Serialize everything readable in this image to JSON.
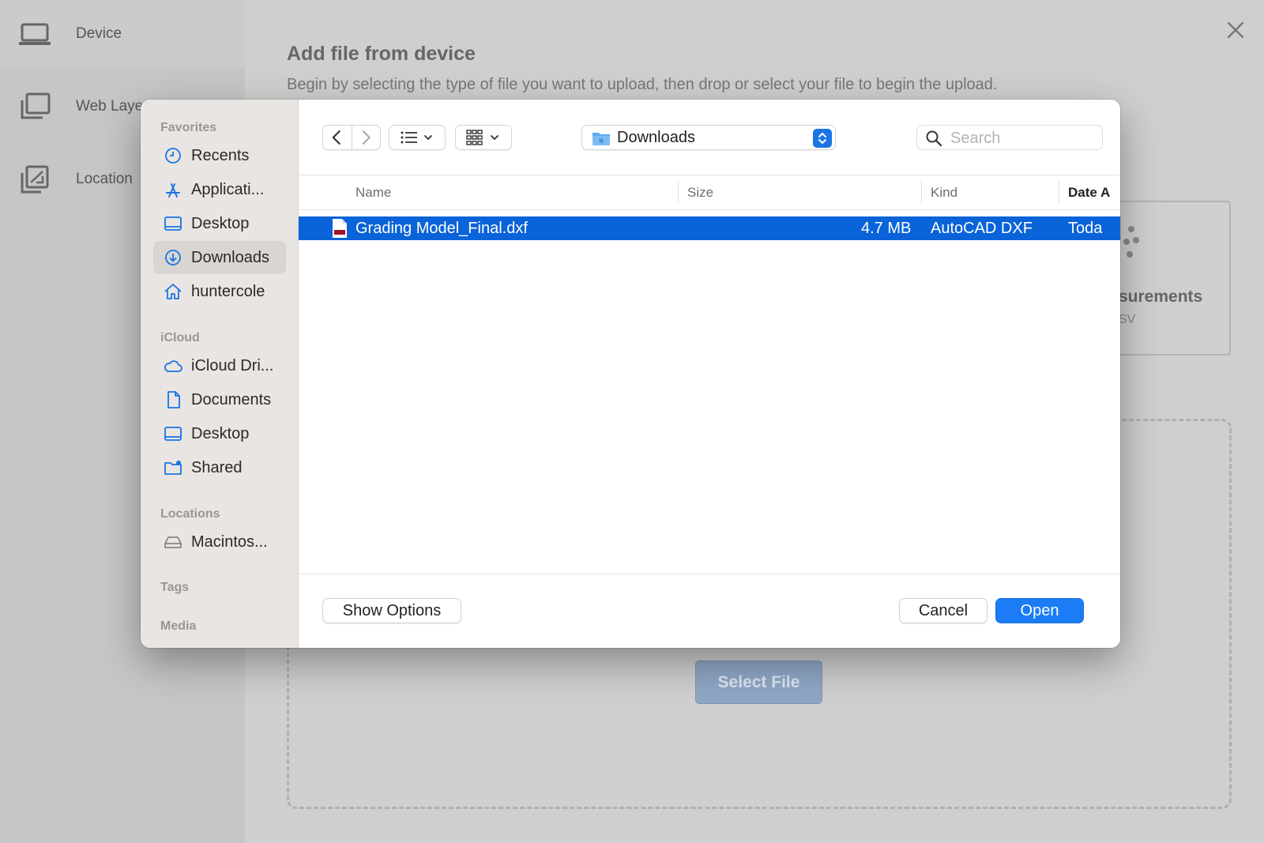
{
  "background": {
    "nav": [
      {
        "label": "Device",
        "icon": "laptop-icon"
      },
      {
        "label": "Web Laye",
        "icon": "layers-icon"
      },
      {
        "label": "Location",
        "icon": "location-layers-icon"
      }
    ],
    "title": "Add file from device",
    "subtitle": "Begin by selecting the type of file you want to upload, then drop or select your file to begin the upload.",
    "card_title": "surements",
    "card_sub": "SV",
    "select_file": "Select File"
  },
  "dialog": {
    "sidebar": {
      "sections": [
        {
          "title": "Favorites",
          "items": [
            {
              "label": "Recents",
              "icon": "clock-icon"
            },
            {
              "label": "Applicati...",
              "icon": "applications-icon"
            },
            {
              "label": "Desktop",
              "icon": "desktop-icon"
            },
            {
              "label": "Downloads",
              "icon": "downloads-icon",
              "selected": true
            },
            {
              "label": "huntercole",
              "icon": "home-icon"
            }
          ]
        },
        {
          "title": "iCloud",
          "items": [
            {
              "label": "iCloud Dri...",
              "icon": "cloud-icon"
            },
            {
              "label": "Documents",
              "icon": "document-icon"
            },
            {
              "label": "Desktop",
              "icon": "desktop-icon"
            },
            {
              "label": "Shared",
              "icon": "shared-folder-icon"
            }
          ]
        },
        {
          "title": "Locations",
          "items": [
            {
              "label": "Macintos...",
              "icon": "disk-icon"
            }
          ]
        },
        {
          "title": "Tags",
          "items": []
        },
        {
          "title": "Media",
          "items": []
        }
      ]
    },
    "toolbar": {
      "path": "Downloads",
      "search_placeholder": "Search"
    },
    "columns": [
      "Name",
      "Size",
      "Kind",
      "Date A"
    ],
    "files": [
      {
        "name": "Grading Model_Final.dxf",
        "size": "4.7 MB",
        "kind": "AutoCAD DXF",
        "date": "Toda"
      }
    ],
    "footer": {
      "show_options": "Show Options",
      "cancel": "Cancel",
      "open": "Open"
    }
  },
  "colors": {
    "selection": "#0a63d8",
    "primary_button": "#1b7cf5",
    "accent_icon": "#1a74e4"
  }
}
